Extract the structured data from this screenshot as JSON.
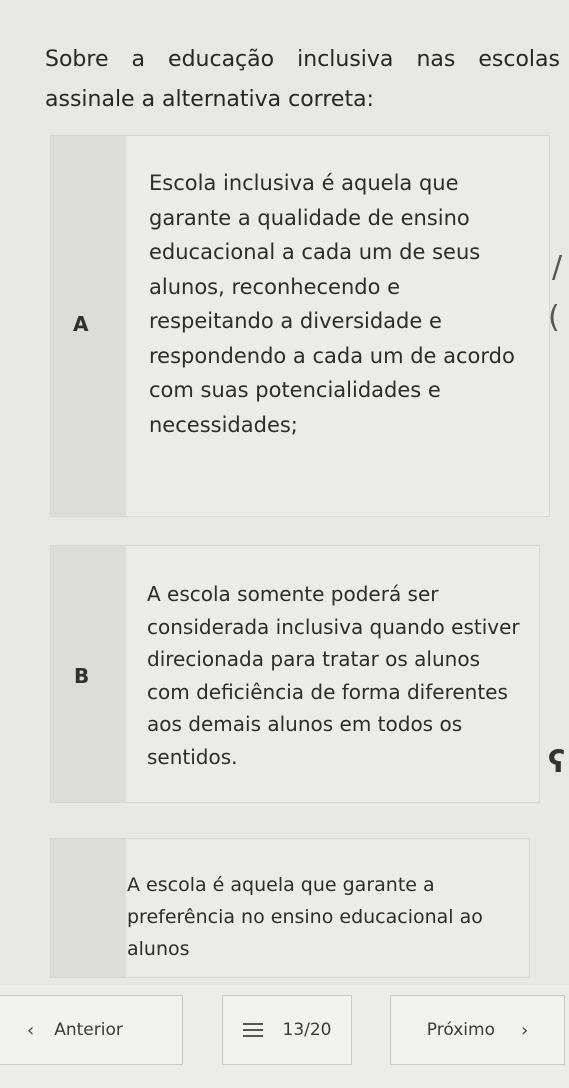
{
  "question": {
    "text": "Sobre a educação inclusiva nas escolas assinale a alternativa correta:"
  },
  "options": [
    {
      "letter": "A",
      "text": "Escola inclusiva é aquela que garante a qualidade de ensino educacional a cada um de seus alunos, reconhecendo e respeitando a diversidade e respondendo a cada um de acordo com suas potencialidades e necessidades;"
    },
    {
      "letter": "B",
      "text": "A escola somente poderá ser considerada inclusiva quando estiver direcionada para tratar os alunos com deficiência de forma diferentes aos demais alunos em todos os sentidos."
    },
    {
      "letter": "",
      "text": "A escola é aquela que garante a preferência no ensino educacional ao alunos"
    }
  ],
  "nav": {
    "prev_label": "Anterior",
    "counter": "13/20",
    "next_label": "Próximo",
    "prev_icon": "chevron-left-icon",
    "next_icon": "chevron-right-icon",
    "list_icon": "list-icon"
  }
}
